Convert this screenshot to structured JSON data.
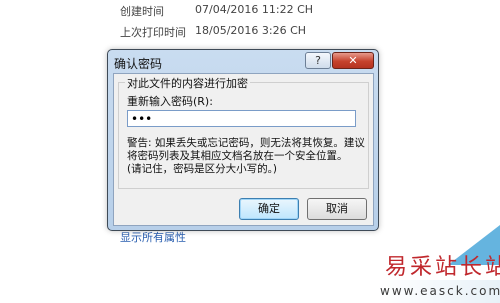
{
  "background": {
    "created_label": "创建时间",
    "created_value": "07/04/2016 11:22 CH",
    "printed_label": "上次打印时间",
    "printed_value": "18/05/2016 3:26 CH",
    "show_all_properties": "显示所有属性"
  },
  "dialog": {
    "title": "确认密码",
    "help_glyph": "?",
    "close_glyph": "✕",
    "group_title": "对此文件的内容进行加密",
    "password_label": "重新输入密码(R):",
    "password_value": "•••",
    "warning_lines": [
      "警告: 如果丢失或忘记密码，则无法将其恢复。建议",
      "将密码列表及其相应文档名放在一个安全位置。",
      "(请记住，密码是区分大小写的。)"
    ],
    "ok_label": "确定",
    "cancel_label": "取消"
  },
  "watermark": {
    "text": "易采站长站",
    "url": "www.easck.com"
  },
  "colors": {
    "title_bar": "#c9dcf0",
    "close_button": "#c6422d",
    "ok_button_border": "#3c7fb1",
    "watermark_red": "#c0282d",
    "watermark_blue": "#4aa7d9"
  }
}
